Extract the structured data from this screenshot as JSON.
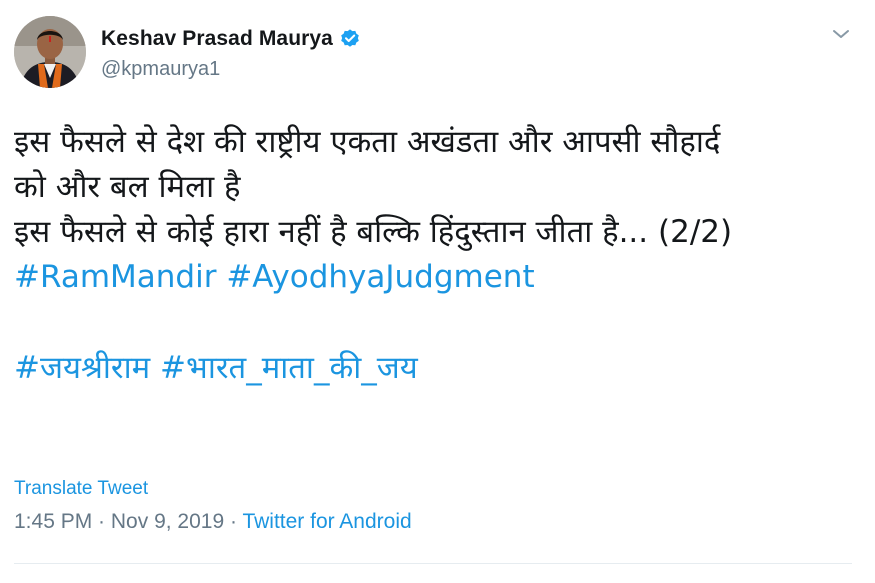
{
  "author": {
    "display_name": "Keshav Prasad Maurya",
    "handle": "@kpmaurya1",
    "verified": true,
    "avatar_icon": "profile-photo"
  },
  "tweet": {
    "lines": [
      "इस फैसले से देश की राष्ट्रीय एकता अखंडता और आपसी सौहार्द",
      "को और बल मिला है",
      " इस फैसले से कोई हारा नहीं है बल्कि हिंदुस्तान जीता है... (2/2)"
    ],
    "hashtags_line1": [
      "#RamMandir",
      "#AyodhyaJudgment"
    ],
    "hashtags_line2": [
      "#जयश्रीराम",
      "#भारत_माता_की_जय"
    ]
  },
  "translate_label": "Translate Tweet",
  "meta": {
    "time": "1:45 PM",
    "separator": " · ",
    "date": "Nov 9, 2019",
    "source": "Twitter for Android"
  },
  "colors": {
    "link": "#1b95e0",
    "text": "#14171a",
    "muted": "#657786",
    "verified": "#1da1f2"
  }
}
